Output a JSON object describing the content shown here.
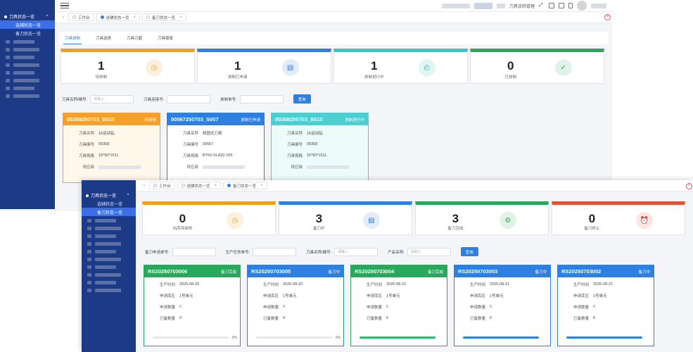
{
  "w1": {
    "sidebar": {
      "group_label": "刀具状态一览",
      "items": [
        {
          "label": "选辅状态一览",
          "active": true
        },
        {
          "label": "备刀状态一览",
          "active": false
        }
      ]
    },
    "tabs": [
      {
        "label": "工作台",
        "active": false,
        "closable": false
      },
      {
        "label": "选辅状态一览",
        "active": true,
        "closable": true
      },
      {
        "label": "备刀状态一览",
        "active": false,
        "closable": true
      }
    ],
    "topbar": {
      "menu_label": "刀具流转管理"
    },
    "subtabs": [
      "刀具放制",
      "刀具选择",
      "刀具刃磨",
      "刀具报废"
    ],
    "stats": [
      {
        "value": "1",
        "label": "待放制",
        "color": "#f0a020",
        "icon_bg": "#fdf0dc",
        "icon_color": "#f0a020",
        "icon": "clock-icon"
      },
      {
        "value": "1",
        "label": "放制已申请",
        "color": "#2d7fe0",
        "icon_bg": "#e2ecfb",
        "icon_color": "#2d7fe0",
        "icon": "clipboard-icon"
      },
      {
        "value": "1",
        "label": "放制进行中",
        "color": "#3cc5c8",
        "icon_bg": "#def6f4",
        "icon_color": "#28b8a8",
        "icon": "timer-icon"
      },
      {
        "value": "0",
        "label": "已放制",
        "color": "#29a85c",
        "icon_bg": "#dff4e6",
        "icon_color": "#29a85c",
        "icon": "check-circle-icon"
      }
    ],
    "filters": [
      {
        "label": "刀具名称/编号:",
        "placeholder": "请输入"
      },
      {
        "label": "刀具连接号:",
        "placeholder": ""
      },
      {
        "label": "放制单号:",
        "placeholder": ""
      }
    ],
    "query_label": "查询",
    "cards": [
      {
        "title": "00358250703_S010",
        "badge": "待放制",
        "color": "#f5a02a",
        "bg": "#fff7ea",
        "rows": [
          {
            "k": "刀具名称",
            "v": "16运动钻"
          },
          {
            "k": "刀具编号",
            "v": "00358"
          },
          {
            "k": "刀具规格",
            "v": "16*90*151L"
          },
          {
            "k": "供应商",
            "v": ""
          }
        ]
      },
      {
        "title": "00567250703_S007",
        "badge": "放制已申请",
        "color": "#2d7fe0",
        "bg": "#ffffff",
        "rows": [
          {
            "k": "刀具名称",
            "v": "侧固式刀柄"
          },
          {
            "k": "刀具编号",
            "v": "00567"
          },
          {
            "k": "刀具规格",
            "v": "BT50-SLA32-105"
          },
          {
            "k": "供应商",
            "v": ""
          }
        ]
      },
      {
        "title": "00358250703_S010",
        "badge": "放制进行中",
        "color": "#4ccfd2",
        "bg": "#eefbfb",
        "rows": [
          {
            "k": "刀具名称",
            "v": "16运动钻"
          },
          {
            "k": "刀具编号",
            "v": "00358"
          },
          {
            "k": "刀具规格",
            "v": "16*90*151L"
          },
          {
            "k": "供应商",
            "v": ""
          }
        ]
      }
    ]
  },
  "w2": {
    "sidebar": {
      "group_label": "刀具状态一览",
      "items": [
        {
          "label": "选辅状态一览",
          "active": false
        },
        {
          "label": "备刀状态一览",
          "active": true
        }
      ]
    },
    "tabs": [
      {
        "label": "工作台",
        "active": false,
        "closable": false
      },
      {
        "label": "选辅状态一览",
        "active": false,
        "closable": true
      },
      {
        "label": "备刀状态一览",
        "active": true,
        "closable": true
      }
    ],
    "stats": [
      {
        "value": "0",
        "label": "出库待审核",
        "color": "#f0a020",
        "icon_bg": "#fdf0dc",
        "icon_color": "#f0a020",
        "icon": "clock-icon"
      },
      {
        "value": "3",
        "label": "备刀中",
        "color": "#2d7fe0",
        "icon_bg": "#e2ecfb",
        "icon_color": "#2d7fe0",
        "icon": "clipboard-icon"
      },
      {
        "value": "3",
        "label": "备刀完成",
        "color": "#29a85c",
        "icon_bg": "#dff4e6",
        "icon_color": "#29a85c",
        "icon": "gear-icon"
      },
      {
        "value": "0",
        "label": "备刀终止",
        "color": "#e0553a",
        "icon_bg": "#fde6e1",
        "icon_color": "#e0553a",
        "icon": "alarm-icon"
      }
    ],
    "filters": [
      {
        "label": "备刀申请单号:",
        "placeholder": ""
      },
      {
        "label": "生产任务单号:",
        "placeholder": ""
      },
      {
        "label": "刀具名称/编号:",
        "placeholder": "请输入"
      },
      {
        "label": "产品名称:",
        "placeholder": "请输入"
      }
    ],
    "query_label": "查询",
    "cards": [
      {
        "title": "RS20250703006",
        "badge": "备刀完成",
        "color": "#29a85c",
        "rows": [
          {
            "k": "生产时间",
            "v": "2025-08-20"
          },
          {
            "k": "申请库区",
            "v": "1号单元"
          },
          {
            "k": "申请数量",
            "v": "6"
          },
          {
            "k": "已备数量",
            "v": "0"
          }
        ],
        "progress": 0,
        "progress_text": "0%"
      },
      {
        "title": "RS20250703005",
        "badge": "备刀中",
        "color": "#2d7fe0",
        "rows": [
          {
            "k": "生产时间",
            "v": "2025-08-20"
          },
          {
            "k": "申请库区",
            "v": "1号单元"
          },
          {
            "k": "申请数量",
            "v": "6"
          },
          {
            "k": "已备数量",
            "v": "0"
          }
        ],
        "progress": 0,
        "progress_text": "0%"
      },
      {
        "title": "RS20250703004",
        "badge": "备刀完成",
        "color": "#29a85c",
        "rows": [
          {
            "k": "生产时间",
            "v": "2025-08-21"
          },
          {
            "k": "申请库区",
            "v": "1号单元"
          },
          {
            "k": "申请数量",
            "v": "6"
          },
          {
            "k": "已备数量",
            "v": "6"
          }
        ],
        "progress": 100,
        "progress_text": ""
      },
      {
        "title": "RS20250703003",
        "badge": "备刀中",
        "color": "#2d7fe0",
        "rows": [
          {
            "k": "生产时间",
            "v": "2025-08-21"
          },
          {
            "k": "申请库区",
            "v": "1号单元"
          },
          {
            "k": "申请数量",
            "v": "6"
          },
          {
            "k": "已备数量",
            "v": "6"
          }
        ],
        "progress": 100,
        "progress_text": ""
      },
      {
        "title": "RS20250703002",
        "badge": "备刀中",
        "color": "#2d7fe0",
        "rows": [
          {
            "k": "生产时间",
            "v": "2025-08-21"
          },
          {
            "k": "申请库区",
            "v": "1号单元"
          },
          {
            "k": "申请数量",
            "v": "6"
          },
          {
            "k": "已备数量",
            "v": "6"
          }
        ],
        "progress": 100,
        "progress_text": ""
      }
    ]
  }
}
